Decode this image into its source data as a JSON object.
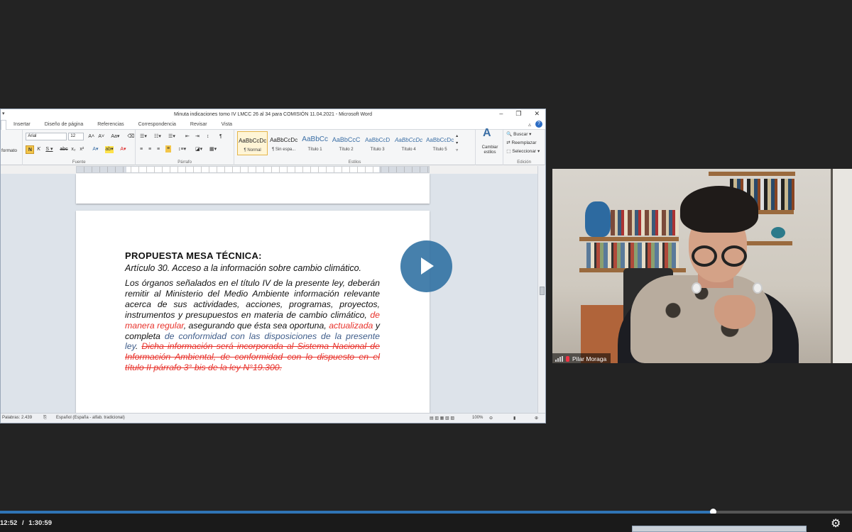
{
  "word": {
    "title": "Minuta indicaciones tomo IV LMCC 26 al 34 para COMISIÓN 11.04.2021 - Microsoft Word",
    "tabs": [
      "Insertar",
      "Diseño de página",
      "Referencias",
      "Correspondencia",
      "Revisar",
      "Vista"
    ],
    "ribbon": {
      "clipboard_label": "formato",
      "font_name": "Arial",
      "font_size": "12",
      "group_fuente": "Fuente",
      "group_parrafo": "Párrafo",
      "group_estilos": "Estilos",
      "group_edicion": "Edición",
      "styles": [
        {
          "sample": "AaBbCcDc",
          "name": "¶ Normal"
        },
        {
          "sample": "AaBbCcDc",
          "name": "¶ Sin espa..."
        },
        {
          "sample": "AaBbCc",
          "name": "Título 1"
        },
        {
          "sample": "AaBbCcC",
          "name": "Título 2"
        },
        {
          "sample": "AaBbCcD",
          "name": "Título 3"
        },
        {
          "sample": "AaBbCcDc",
          "name": "Título 4"
        },
        {
          "sample": "AaBbCcDc",
          "name": "Título 5"
        }
      ],
      "change_styles": "Cambiar estilos",
      "find": "Buscar",
      "replace": "Reemplazar",
      "select": "Seleccionar"
    },
    "document": {
      "heading": "PROPUESTA MESA TÉCNICA:",
      "article": "Artículo 30.   Acceso a la información sobre cambio climático.",
      "p1": "Los órganos señalados en el título IV de la presente ley, deberán remitir al Ministerio del Medio Ambiente información relevante acerca de sus actividades, acciones, programas, proyectos, instrumentos y presupuestos en materia de cambio climático, ",
      "red1": "de manera regular",
      "p2": ", asegurando que ésta sea oportuna, ",
      "red2": "actualizada",
      "p3": " y completa ",
      "blue1": "de conformidad con las disposiciones de la presente ley",
      "p4": ". ",
      "struck": "Dicha información será incorporada al Sistema Nacional de Información Ambiental, de conformidad con lo dispuesto en el título II párrafo 3° bis de la ley N°19.300."
    },
    "status": {
      "words": "Palabras: 2.439",
      "language": "Español (España - alfab. tradicional)",
      "zoom": "100%"
    }
  },
  "camera": {
    "participant_name": "Pilar Moraga"
  },
  "player": {
    "current_time": "12:52",
    "separator": "/",
    "total_time": "1:30:59",
    "progress": 0.837
  },
  "colors": {
    "accent": "#2f74b5",
    "redline": "#e8322b"
  }
}
